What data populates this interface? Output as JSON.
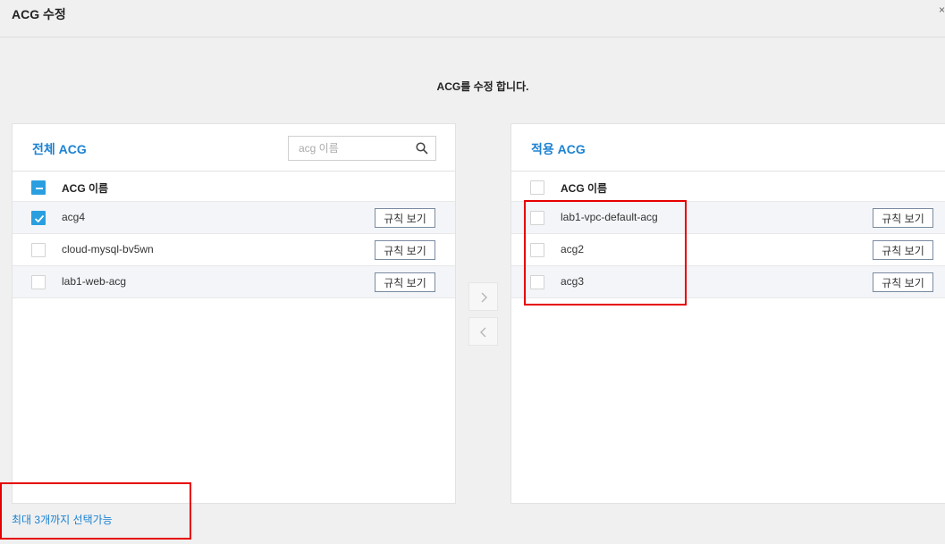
{
  "header": {
    "title": "ACG 수정",
    "close_glyph": "×"
  },
  "subtitle": "ACG를 수정 합니다.",
  "left_panel": {
    "title": "전체 ACG",
    "search": {
      "placeholder": "acg 이름",
      "value": ""
    },
    "column_header": "ACG 이름",
    "header_checkbox": "partial",
    "rows": [
      {
        "name": "acg4",
        "checked": true,
        "button": "규칙 보기"
      },
      {
        "name": "cloud-mysql-bv5wn",
        "checked": false,
        "button": "규칙 보기"
      },
      {
        "name": "lab1-web-acg",
        "checked": false,
        "button": "규칙 보기"
      }
    ]
  },
  "right_panel": {
    "title": "적용 ACG",
    "column_header": "ACG 이름",
    "header_checkbox": "unchecked",
    "rows": [
      {
        "name": "lab1-vpc-default-acg",
        "checked": false,
        "button": "규칙 보기"
      },
      {
        "name": "acg2",
        "checked": false,
        "button": "규칙 보기"
      },
      {
        "name": "acg3",
        "checked": false,
        "button": "규칙 보기"
      }
    ]
  },
  "transfer": {
    "add_icon": "chevron-right-icon",
    "remove_icon": "chevron-left-icon"
  },
  "footer_note": "최대 3개까지 선택가능",
  "colors": {
    "accent": "#1b82d2",
    "checkbox": "#2a9fe0",
    "highlight": "#e60000"
  }
}
